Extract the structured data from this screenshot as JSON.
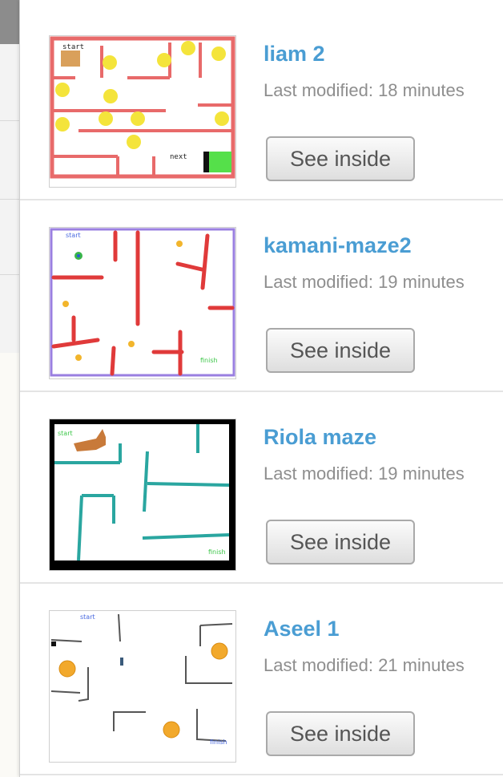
{
  "projects": [
    {
      "title": "liam 2",
      "modified": "Last modified: 18 minutes",
      "button": "See inside",
      "thumb_labels": {
        "start": "start",
        "goal": "next"
      }
    },
    {
      "title": "kamani-maze2",
      "modified": "Last modified: 19 minutes",
      "button": "See inside",
      "thumb_labels": {
        "start": "start",
        "goal": "finish"
      }
    },
    {
      "title": "Riola maze",
      "modified": "Last modified: 19 minutes",
      "button": "See inside",
      "thumb_labels": {
        "start": "start",
        "goal": "finish"
      }
    },
    {
      "title": "Aseel 1",
      "modified": "Last modified: 21 minutes",
      "button": "See inside",
      "thumb_labels": {
        "start": "start",
        "goal": "finish"
      }
    }
  ],
  "colors": {
    "title": "#4a9dd3",
    "maze_red": "#e86a6a",
    "maze_purple_border": "#9a7fe0",
    "maze_teal": "#2aa6a0",
    "coin_yellow": "#f4e43b",
    "orb_orange": "#f2a92c"
  }
}
